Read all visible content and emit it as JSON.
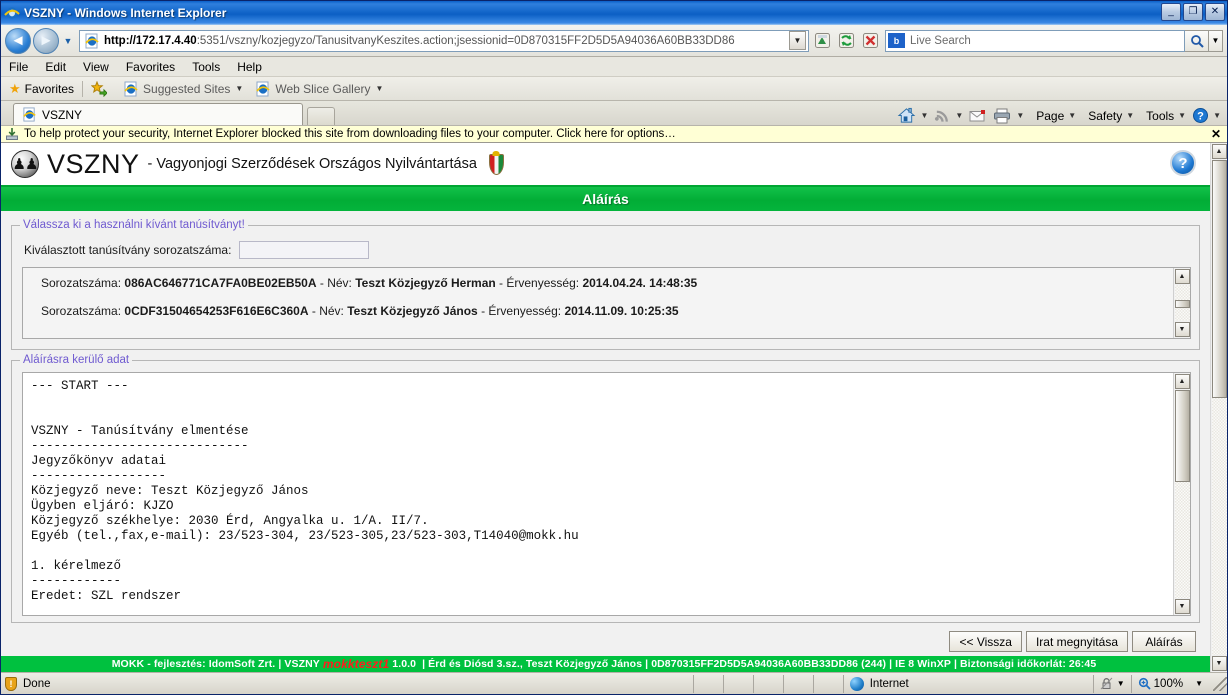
{
  "window": {
    "title": "VSZNY - Windows Internet Explorer",
    "minimize": "_",
    "maximize": "❐",
    "close": "✕"
  },
  "address": {
    "url_bold": "http://172.17.4.40",
    "url_rest": ":5351/vszny/kozjegyzo/TanusitvanyKeszites.action;jsessionid=0D870315FF2D5D5A94036A60BB33DD86",
    "dropdown": "▼",
    "back": "◄",
    "forward": "►",
    "nav_dropdown": "▼",
    "compat_icon": "compatibility-view-icon",
    "refresh": "↻",
    "stop": "✕"
  },
  "search": {
    "placeholder": "Live Search",
    "brand": "b",
    "go": "🔍",
    "dropdown": "▼"
  },
  "menubar": {
    "items": [
      "File",
      "Edit",
      "View",
      "Favorites",
      "Tools",
      "Help"
    ]
  },
  "favbar": {
    "favorites_label": "Favorites",
    "add_label": "",
    "items": [
      {
        "label": "Suggested Sites",
        "caret": "▼"
      },
      {
        "label": "Web Slice Gallery",
        "caret": "▼"
      }
    ]
  },
  "tabs": {
    "items": [
      {
        "label": "VSZNY"
      }
    ],
    "newtab_label": ""
  },
  "commandbar": {
    "home": "home-icon",
    "feeds": "feeds-icon",
    "mail": "mail-icon",
    "print": "print-icon",
    "page": "Page",
    "safety": "Safety",
    "tools": "Tools",
    "help": "?",
    "caret": "▼"
  },
  "infobar": {
    "message": "To help protect your security, Internet Explorer blocked this site from downloading files to your computer. Click here for options…",
    "close": "✕"
  },
  "brand": {
    "name": "VSZNY",
    "subtitle": "- Vagyonjogi Szerződések Országos Nyilvántartása",
    "help": "?"
  },
  "pageheader": {
    "title": "Aláírás"
  },
  "cert_group": {
    "legend": "Válassza ki a használni kívánt tanúsítványt!",
    "field_label": "Kiválasztott tanúsítvány sorozatszáma:",
    "field_value": "",
    "certificates": [
      {
        "serial_label": "Sorozatszáma:",
        "serial": "086AC646771CA7FA0BE02EB50A",
        "name_label": "- Név:",
        "name": "Teszt Közjegyző Herman",
        "valid_label": "- Érvenyesség:",
        "valid": "2014.04.24. 14:48:35"
      },
      {
        "serial_label": "Sorozatszáma:",
        "serial": "0CDF31504654253F616E6C360A",
        "name_label": "- Név:",
        "name": "Teszt Közjegyző János",
        "valid_label": "- Érvenyesség:",
        "valid": "2014.11.09. 10:25:35"
      }
    ]
  },
  "data_group": {
    "legend": "Aláírásra kerülő adat",
    "text": "--- START ---\n\n\nVSZNY - Tanúsítvány elmentése\n-----------------------------\nJegyzőkönyv adatai\n------------------\nKözjegyző neve: Teszt Közjegyző János\nÜgyben eljáró: KJZO\nKözjegyző székhelye: 2030 Érd, Angyalka u. 1/A. II/7.\nEgyéb (tel.,fax,e-mail): 23/523-304, 23/523-305,23/523-303,T14040@mokk.hu\n\n1. kérelmező\n------------\nEredet: SZL rendszer"
  },
  "buttons": {
    "back": "<< Vissza",
    "open_document": "Irat megnyitása",
    "sign": "Aláírás"
  },
  "footer": {
    "text_1": "MOKK - fejlesztés: IdomSoft Zrt.",
    "sep_1": "| VSZNY",
    "env": "mokkteszt1",
    "version": "1.0.0",
    "sep_2": "|",
    "office": "Érd és Diósd 3.sz., Teszt Közjegyző János",
    "sep_3": "|",
    "session": "0D870315FF2D5D5A94036A60BB33DD86 (244)",
    "sep_4": "|",
    "browser": "IE 8 WinXP",
    "sep_5": "|",
    "timeout_label": "Biztonsági időkorlát:",
    "timeout": "26:45"
  },
  "statusbar": {
    "status": "Done",
    "zone": "Internet",
    "protected_mode": "",
    "zoom": "100%",
    "caret": "▼"
  },
  "scroll": {
    "up": "▲",
    "down": "▼"
  },
  "colors": {
    "green": "#00c13f",
    "header_green": "#02ad36",
    "legend_purple": "#6f5ad0",
    "infobar_yellow": "#ffffd5",
    "title_blue": "#0b5fc4",
    "red": "#ff1d1d"
  }
}
